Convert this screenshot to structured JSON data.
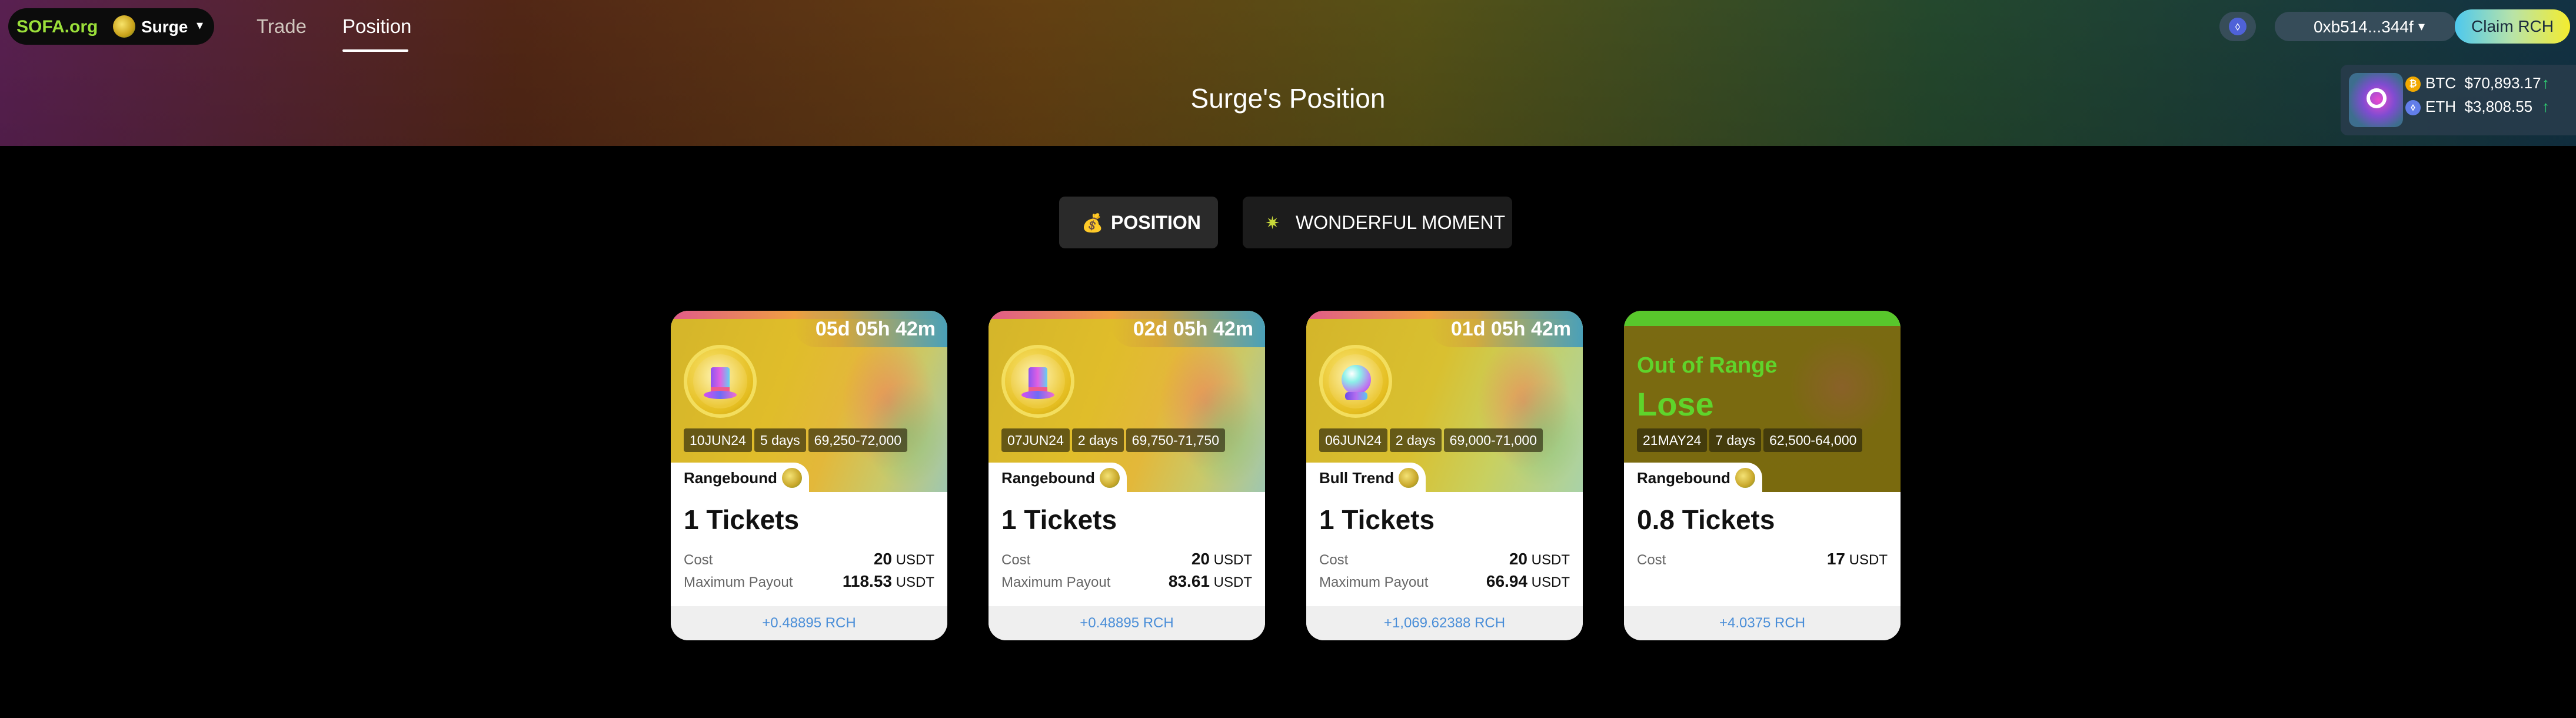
{
  "header": {
    "logo": "SOFA.org",
    "account_label": "Surge",
    "nav": {
      "trade": "Trade",
      "position": "Position"
    },
    "wallet": "0xb514...344f",
    "claim_button": "Claim  RCH",
    "page_title": "Surge's Position",
    "prices": [
      {
        "symbol": "BTC",
        "price": "$70,893.17",
        "trend": "up"
      },
      {
        "symbol": "ETH",
        "price": "$3,808.55",
        "trend": "up"
      }
    ]
  },
  "tabs": [
    {
      "label": "POSITION",
      "icon": "money-bag-icon",
      "active": true
    },
    {
      "label": "WONDERFUL MOMENT",
      "icon": "sparkle-icon",
      "active": false
    }
  ],
  "cards": [
    {
      "timer": "05d 05h 42m",
      "chips": [
        "10JUN24",
        "5 days",
        "69,250-72,000"
      ],
      "type": "Rangebound",
      "tickets": "1 Tickets",
      "cost_label": "Cost",
      "cost_value": "20",
      "cost_unit": "USDT",
      "payout_label": "Maximum Payout",
      "payout_value": "118.53",
      "payout_unit": "USDT",
      "reward": "+0.48895 RCH",
      "icon": "top-hat-icon"
    },
    {
      "timer": "02d 05h 42m",
      "chips": [
        "07JUN24",
        "2 days",
        "69,750-71,750"
      ],
      "type": "Rangebound",
      "tickets": "1 Tickets",
      "cost_label": "Cost",
      "cost_value": "20",
      "cost_unit": "USDT",
      "payout_label": "Maximum Payout",
      "payout_value": "83.61",
      "payout_unit": "USDT",
      "reward": "+0.48895 RCH",
      "icon": "top-hat-icon"
    },
    {
      "timer": "01d 05h 42m",
      "chips": [
        "06JUN24",
        "2 days",
        "69,000-71,000"
      ],
      "type": "Bull Trend",
      "tickets": "1 Tickets",
      "cost_label": "Cost",
      "cost_value": "20",
      "cost_unit": "USDT",
      "payout_label": "Maximum Payout",
      "payout_value": "66.94",
      "payout_unit": "USDT",
      "reward": "+1,069.62388 RCH",
      "icon": "crystal-ball-icon"
    },
    {
      "status": "Out of Range",
      "result": "Lose",
      "chips": [
        "21MAY24",
        "7 days",
        "62,500-64,000"
      ],
      "type": "Rangebound",
      "tickets": "0.8 Tickets",
      "cost_label": "Cost",
      "cost_value": "17",
      "cost_unit": "USDT",
      "reward": "+4.0375 RCH"
    }
  ],
  "colors": {
    "accent_green": "#5fd42b",
    "link_blue": "#4a8ed8",
    "logo_green": "#9be03a"
  }
}
